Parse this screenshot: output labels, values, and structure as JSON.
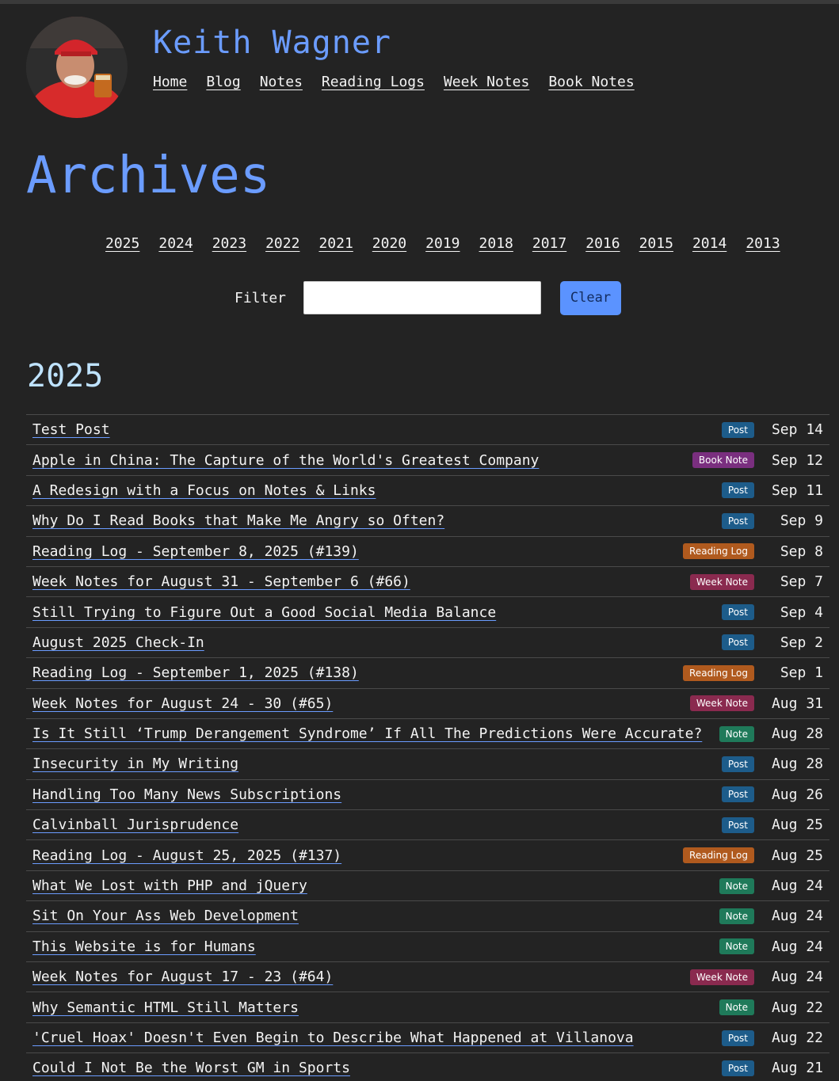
{
  "site": {
    "title": "Keith Wagner",
    "nav": [
      "Home",
      "Blog",
      "Notes",
      "Reading Logs",
      "Week Notes",
      "Book Notes"
    ]
  },
  "page": {
    "title": "Archives",
    "years": [
      "2025",
      "2024",
      "2023",
      "2022",
      "2021",
      "2020",
      "2019",
      "2018",
      "2017",
      "2016",
      "2015",
      "2014",
      "2013"
    ],
    "filter": {
      "label": "Filter",
      "value": "",
      "clear_label": "Clear"
    },
    "current_year": "2025"
  },
  "badge_colors": {
    "Post": "#1d5c8a",
    "Book Note": "#7a2f7f",
    "Reading Log": "#b05a1e",
    "Week Note": "#8a2a4f",
    "Note": "#1f7a5a"
  },
  "posts": [
    {
      "title": "Test Post",
      "type": "Post",
      "date": "Sep 14"
    },
    {
      "title": "Apple in China: The Capture of the World's Greatest Company",
      "type": "Book Note",
      "date": "Sep 12"
    },
    {
      "title": "A Redesign with a Focus on Notes & Links",
      "type": "Post",
      "date": "Sep 11"
    },
    {
      "title": "Why Do I Read Books that Make Me Angry so Often?",
      "type": "Post",
      "date": "Sep 9"
    },
    {
      "title": "Reading Log - September 8, 2025 (#139)",
      "type": "Reading Log",
      "date": "Sep 8"
    },
    {
      "title": "Week Notes for August 31 - September 6 (#66)",
      "type": "Week Note",
      "date": "Sep 7"
    },
    {
      "title": "Still Trying to Figure Out a Good Social Media Balance",
      "type": "Post",
      "date": "Sep 4"
    },
    {
      "title": "August 2025 Check-In",
      "type": "Post",
      "date": "Sep 2"
    },
    {
      "title": "Reading Log - September 1, 2025 (#138)",
      "type": "Reading Log",
      "date": "Sep 1"
    },
    {
      "title": "Week Notes for August 24 - 30 (#65)",
      "type": "Week Note",
      "date": "Aug 31"
    },
    {
      "title": "Is It Still ‘Trump Derangement Syndrome’ If All The Predictions Were Accurate?",
      "type": "Note",
      "date": "Aug 28"
    },
    {
      "title": "Insecurity in My Writing",
      "type": "Post",
      "date": "Aug 28"
    },
    {
      "title": "Handling Too Many News Subscriptions",
      "type": "Post",
      "date": "Aug 26"
    },
    {
      "title": "Calvinball Jurisprudence",
      "type": "Post",
      "date": "Aug 25"
    },
    {
      "title": "Reading Log - August 25, 2025 (#137)",
      "type": "Reading Log",
      "date": "Aug 25"
    },
    {
      "title": "What We Lost with PHP and jQuery",
      "type": "Note",
      "date": "Aug 24"
    },
    {
      "title": "Sit On Your Ass Web Development",
      "type": "Note",
      "date": "Aug 24"
    },
    {
      "title": "This Website is for Humans",
      "type": "Note",
      "date": "Aug 24"
    },
    {
      "title": "Week Notes for August 17 - 23 (#64)",
      "type": "Week Note",
      "date": "Aug 24"
    },
    {
      "title": "Why Semantic HTML Still Matters",
      "type": "Note",
      "date": "Aug 22"
    },
    {
      "title": "'Cruel Hoax' Doesn't Even Begin to Describe What Happened at Villanova",
      "type": "Post",
      "date": "Aug 22"
    },
    {
      "title": "Could I Not Be the Worst GM in Sports",
      "type": "Post",
      "date": "Aug 21"
    }
  ]
}
